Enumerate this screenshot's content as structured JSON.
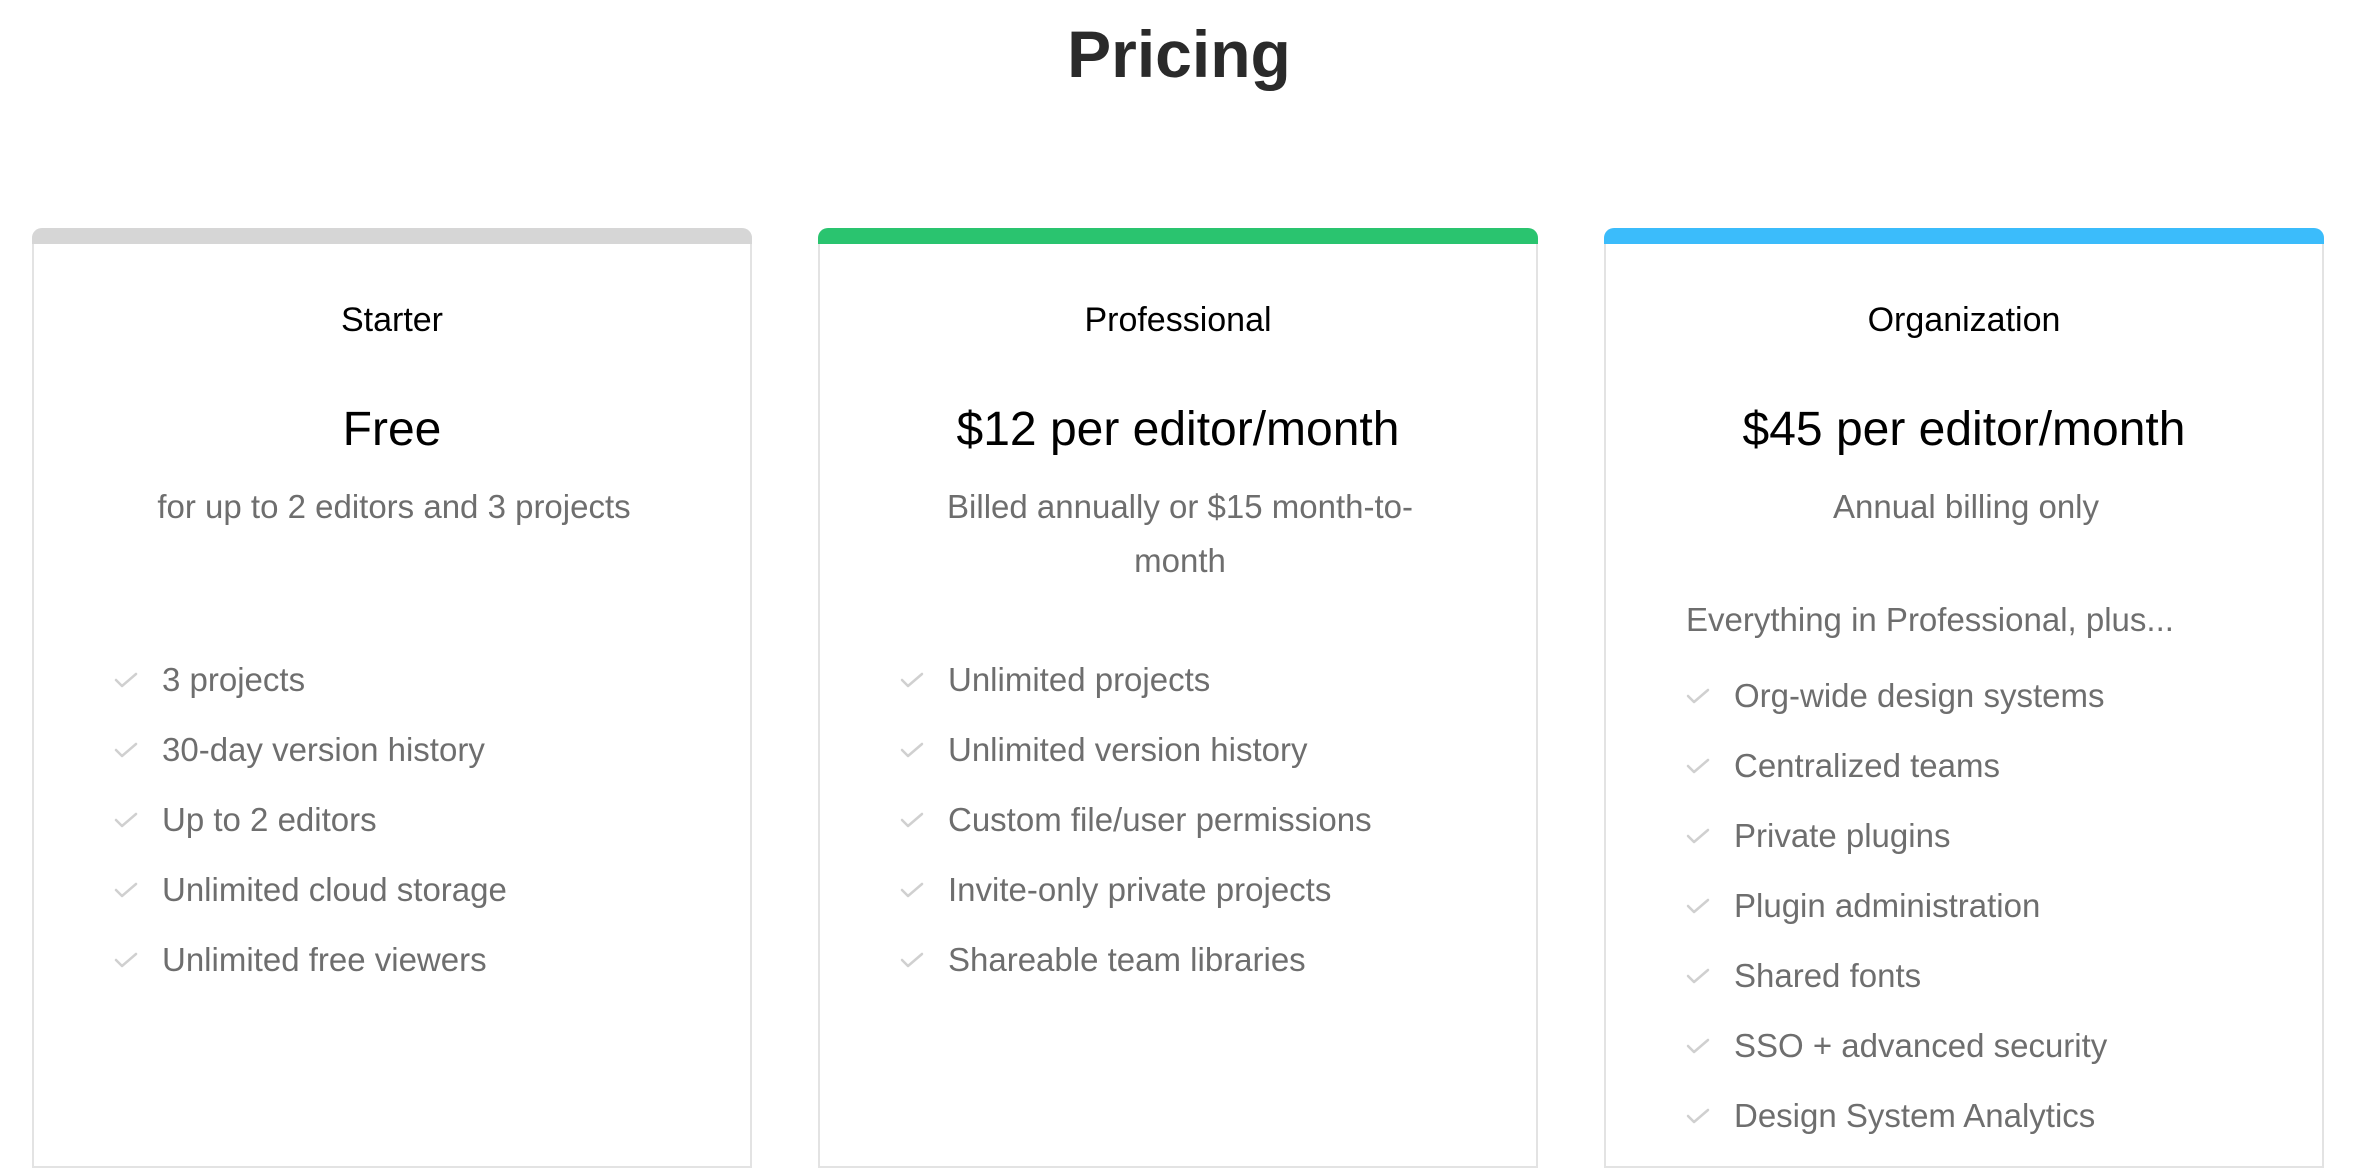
{
  "page": {
    "title": "Pricing"
  },
  "colors": {
    "starter_accent": "#d6d6d6",
    "professional_accent": "#2ac46f",
    "organization_accent": "#3bbcfb",
    "muted_text": "#6e6e6e",
    "check": "#d0d0d0"
  },
  "plans": [
    {
      "name": "Starter",
      "price": "Free",
      "note": "for up to 2 editors and 3 projects",
      "intro": "",
      "features": [
        "3 projects",
        "30-day version history",
        "Up to 2 editors",
        "Unlimited cloud storage",
        "Unlimited free viewers"
      ]
    },
    {
      "name": "Professional",
      "price": "$12 per editor/month",
      "note": "Billed annually or $15 month-to-month",
      "intro": "",
      "features": [
        "Unlimited projects",
        "Unlimited version history",
        "Custom file/user permissions",
        "Invite-only private projects",
        "Shareable team libraries"
      ]
    },
    {
      "name": "Organization",
      "price": "$45 per editor/month",
      "note": "Annual billing only",
      "intro": "Everything in Professional, plus...",
      "features": [
        "Org-wide design systems",
        "Centralized teams",
        "Private plugins",
        "Plugin administration",
        "Shared fonts",
        "SSO + advanced security",
        "Design System Analytics"
      ]
    }
  ],
  "icons": {
    "feature_bullet": "check-icon"
  }
}
